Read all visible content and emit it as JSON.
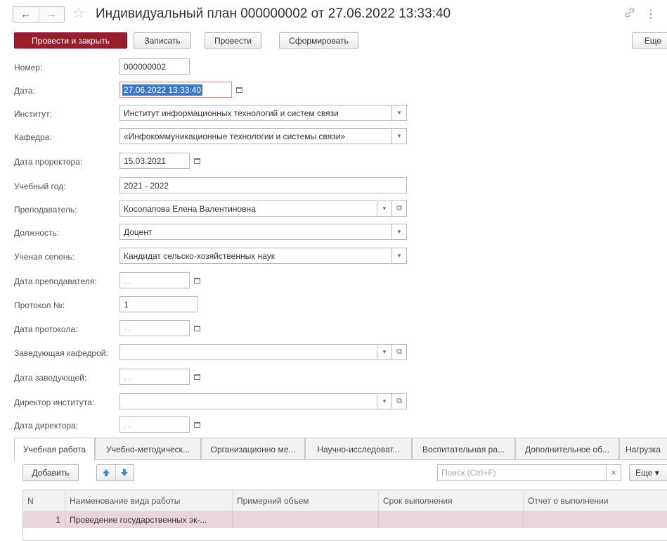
{
  "window": {
    "title": "Индивидуальный план 000000002 от 27.06.2022 13:33:40",
    "back_icon": "arrow-left",
    "forward_icon": "arrow-right"
  },
  "toolbar": {
    "post_close": "Провести и закрыть",
    "save": "Записать",
    "post": "Провести",
    "generate": "Сформировать",
    "more": "Еще"
  },
  "form": {
    "number": {
      "label": "Номер:",
      "value": "000000002"
    },
    "date": {
      "label": "Дата:",
      "value": "27.06.2022 13:33:40"
    },
    "institute": {
      "label": "Институт:",
      "value": "Институт информационных технологий и систем связи"
    },
    "department": {
      "label": "Кафедра:",
      "value": "«Инфокоммуникационные технологии и системы связи»"
    },
    "prorector_date": {
      "label": "Дата проректора:",
      "value": "15.03.2021"
    },
    "academic_year": {
      "label": "Учебный год:",
      "value": "2021 - 2022"
    },
    "teacher": {
      "label": "Преподаватель:",
      "value": "Косолапова Елена Валентиновна"
    },
    "position": {
      "label": "Должность:",
      "value": "Доцент"
    },
    "degree": {
      "label": "Ученая сеnень:",
      "value": "Кандидат сельско-хозяйственных наук"
    },
    "teacher_date": {
      "label": "Дата преподавателя:",
      "value": " .  ."
    },
    "protocol_no": {
      "label": "Протокол №:",
      "value": "1"
    },
    "protocol_date": {
      "label": "Дата протокола:",
      "value": " .  ."
    },
    "head_department": {
      "label": "Заведующая кафедрой:",
      "value": ""
    },
    "head_date": {
      "label": "Дата заведующей:",
      "value": " .  ."
    },
    "director": {
      "label": "Директор института:",
      "value": ""
    },
    "director_date": {
      "label": "Дата директора:",
      "value": " .  ."
    }
  },
  "tabs": [
    {
      "label": "Учебная работа"
    },
    {
      "label": "Учебно-методическ..."
    },
    {
      "label": "Организационно ме..."
    },
    {
      "label": "Научно-исследоват..."
    },
    {
      "label": "Воспитательная ра..."
    },
    {
      "label": "Дополнительное об..."
    },
    {
      "label": "Нагрузка"
    }
  ],
  "table_toolbar": {
    "add": "Добавить",
    "search_placeholder": "Поиск (Ctrl+F)",
    "clear": "×",
    "more": "Еще ▾"
  },
  "table": {
    "columns": [
      "N",
      "Наименование вида работы",
      "Примерний объем",
      "Срок выполнения",
      "Отчет о выполнении"
    ],
    "rows": [
      {
        "n": "1",
        "name": "Проведение государственных эк-...",
        "volume": "",
        "deadline": "",
        "report": ""
      }
    ]
  },
  "colors": {
    "primary_button": "#9a1d2c",
    "selected_row": "#e8d6da",
    "accent_arrow": "#3a8fd8"
  }
}
